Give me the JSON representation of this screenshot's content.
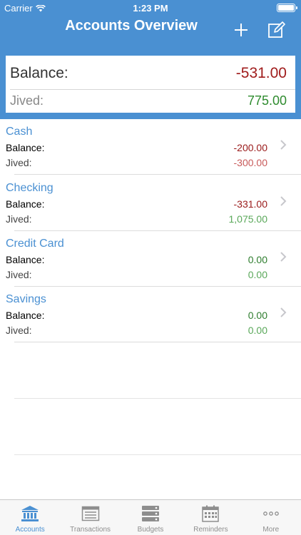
{
  "status_bar": {
    "carrier": "Carrier",
    "time": "1:23 PM"
  },
  "nav": {
    "title": "Accounts Overview",
    "add_icon": "plus-icon",
    "edit_icon": "compose-icon"
  },
  "summary": {
    "balance_label": "Balance:",
    "balance_value": "-531.00",
    "jived_label": "Jived:",
    "jived_value": "775.00"
  },
  "accounts": [
    {
      "name": "Cash",
      "balance_label": "Balance:",
      "balance": "-200.00",
      "jived_label": "Jived:",
      "jived": "-300.00"
    },
    {
      "name": "Checking",
      "balance_label": "Balance:",
      "balance": "-331.00",
      "jived_label": "Jived:",
      "jived": "1,075.00"
    },
    {
      "name": "Credit Card",
      "balance_label": "Balance:",
      "balance": "0.00",
      "jived_label": "Jived:",
      "jived": "0.00"
    },
    {
      "name": "Savings",
      "balance_label": "Balance:",
      "balance": "0.00",
      "jived_label": "Jived:",
      "jived": "0.00"
    }
  ],
  "colors": {
    "accent": "#4a90d2",
    "negative": "#9a1a1a",
    "positive": "#2e7d2e"
  },
  "tabs": [
    {
      "label": "Accounts",
      "icon": "bank-icon",
      "active": true
    },
    {
      "label": "Transactions",
      "icon": "transactions-icon",
      "active": false
    },
    {
      "label": "Budgets",
      "icon": "budgets-icon",
      "active": false
    },
    {
      "label": "Reminders",
      "icon": "calendar-icon",
      "active": false
    },
    {
      "label": "More",
      "icon": "more-icon",
      "active": false
    }
  ]
}
